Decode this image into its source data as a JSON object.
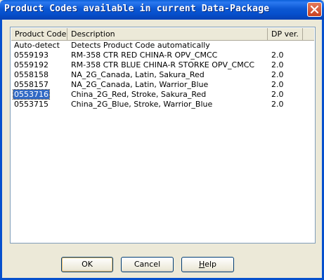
{
  "window": {
    "title": "Product Codes available in current Data-Package",
    "colors": {
      "titlebar": "#0a5fd8",
      "close": "#c8401f",
      "selection": "#316ac5"
    }
  },
  "list": {
    "columns": [
      "Product Code",
      "Description",
      "DP ver.",
      ""
    ],
    "rows": [
      {
        "code": "Auto-detect",
        "description": "Detects Product Code automatically",
        "version": ""
      },
      {
        "code": "0559193",
        "description": "RM-358 CTR RED CHINA-R OPV_CMCC",
        "version": "2.0"
      },
      {
        "code": "0559192",
        "description": "RM-358 CTR BLUE CHINA-R STORKE OPV_CMCC",
        "version": "2.0"
      },
      {
        "code": "0558158",
        "description": "NA_2G_Canada, Latin, Sakura_Red",
        "version": "2.0"
      },
      {
        "code": "0558157",
        "description": "NA_2G_Canada, Latin, Warrior_Blue",
        "version": "2.0"
      },
      {
        "code": "0553716",
        "description": "China_2G_Red, Stroke, Sakura_Red",
        "version": "2.0",
        "selected": true
      },
      {
        "code": "0553715",
        "description": "China_2G_Blue, Stroke, Warrior_Blue",
        "version": "2.0"
      }
    ]
  },
  "buttons": {
    "ok": "OK",
    "cancel": "Cancel",
    "help_first": "H",
    "help_rest": "elp"
  },
  "icons": {
    "close": "close-icon"
  }
}
